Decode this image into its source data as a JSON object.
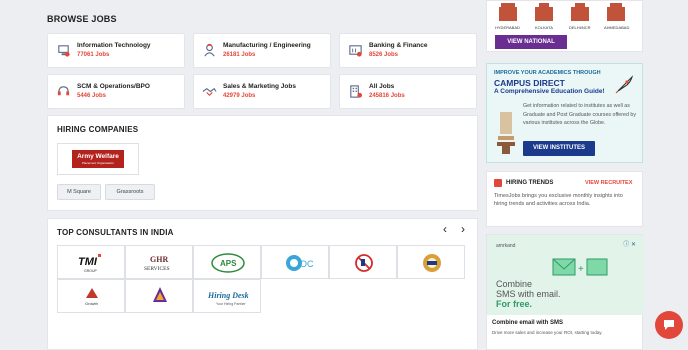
{
  "browse": {
    "title": "BROWSE JOBS",
    "jobs": [
      {
        "name": "Information Technology",
        "count": "77061 Jobs",
        "icon": "it-icon"
      },
      {
        "name": "Manufacturing / Engineering",
        "count": "26181 Jobs",
        "icon": "engineering-icon"
      },
      {
        "name": "Banking & Finance",
        "count": "8526 Jobs",
        "icon": "bank-icon"
      },
      {
        "name": "SCM & Operations/BPO",
        "count": "5446 Jobs",
        "icon": "headset-icon"
      },
      {
        "name": "Sales & Marketing Jobs",
        "count": "42979 Jobs",
        "icon": "handshake-icon"
      },
      {
        "name": "All Jobs",
        "count": "245816 Jobs",
        "icon": "building-icon"
      }
    ]
  },
  "hiring": {
    "title": "HIRING COMPANIES",
    "company": {
      "line1": "Army Welfare",
      "line2": "Placement Organisation"
    },
    "chips": [
      "M Square",
      "Grassroots"
    ]
  },
  "consultants": {
    "title": "TOP CONSULTANTS IN INDIA",
    "prev": "‹",
    "next": "›",
    "logos": [
      {
        "text": "TMI",
        "sub": "GROUP"
      },
      {
        "text": "GHR",
        "sub": "SERVICES"
      },
      {
        "text": "APS",
        "sub": ""
      },
      {
        "text": "OC",
        "sub": ""
      },
      {
        "text": "",
        "sub": ""
      },
      {
        "text": "",
        "sub": ""
      },
      {
        "text": "Growth",
        "sub": ""
      },
      {
        "text": "",
        "sub": ""
      },
      {
        "text": "Hiring Desk",
        "sub": "Your Hiring Partner"
      }
    ]
  },
  "national": {
    "cities": [
      "HYDERABAD",
      "KOLKATA",
      "DELHI/NCR",
      "AHMEDABAD"
    ],
    "button": "VIEW NATIONAL"
  },
  "campus": {
    "line1": "IMPROVE YOUR ACADEMICS THROUGH",
    "line2": "CAMPUS DIRECT",
    "line3": "A Comprehensive Education Guide!",
    "desc": "Get information related to institutes as well as Graduate and Post Graduate courses offered by various institutes across the Globe.",
    "button": "VIEW INSTITUTES"
  },
  "trends": {
    "title": "HIRING TRENDS",
    "link": "VIEW RECRUITEX",
    "desc": "TimesJobs brings you exclusive monthly insights into hiring trends and activities across India."
  },
  "ad": {
    "brand": "amrkand",
    "headline1": "Combine",
    "headline2": "SMS with email.",
    "headline3": "For free.",
    "title": "Combine email with SMS",
    "desc": "Drive more sales and increase your ROI, starting today."
  },
  "colors": {
    "accent": "#e2473b",
    "navy": "#1b3a8c",
    "purple": "#6a2d91"
  }
}
